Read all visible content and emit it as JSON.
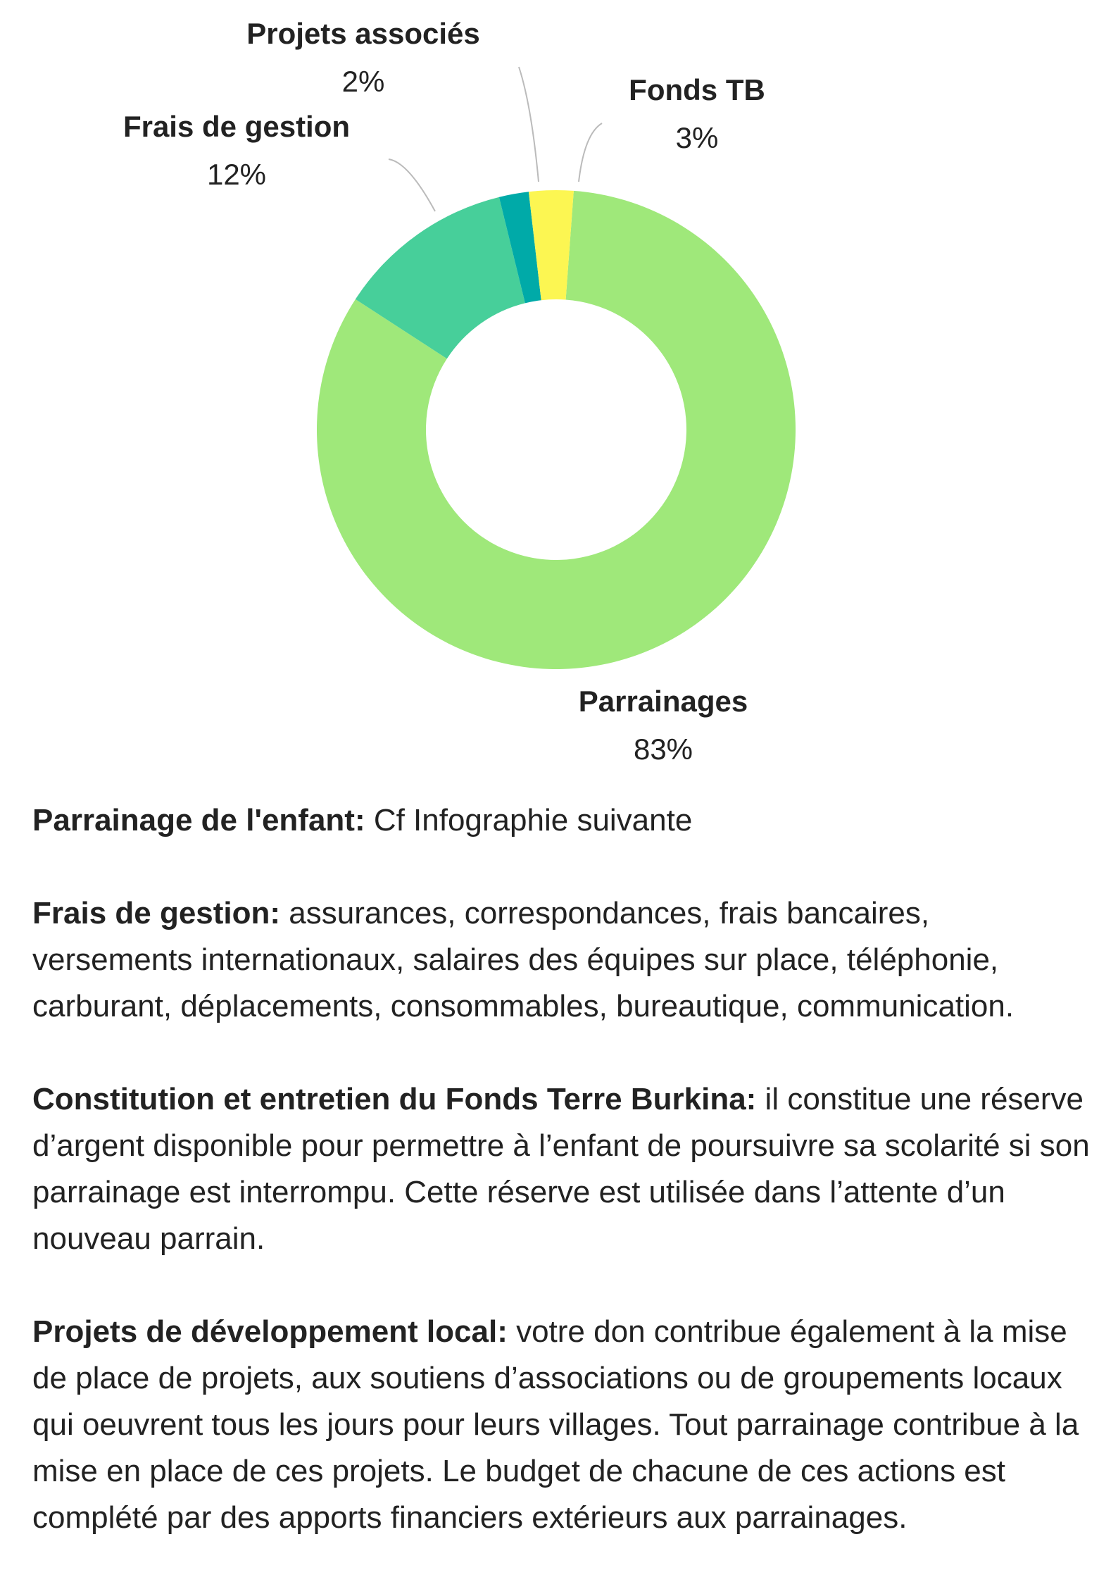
{
  "chart_data": {
    "type": "pie",
    "variant": "donut",
    "categories": [
      "Parrainages",
      "Frais de gestion",
      "Projets associés",
      "Fonds TB"
    ],
    "values": [
      83,
      12,
      2,
      3
    ],
    "value_labels": [
      "83%",
      "12%",
      "2%",
      "3%"
    ],
    "colors": [
      "#9fe87a",
      "#47cf9a",
      "#00aaa8",
      "#fcf652"
    ],
    "title": "",
    "legend": "none"
  },
  "description": [
    {
      "term": "Parrainage de l'enfant:",
      "text": " Cf Infographie suivante"
    },
    {
      "term": "Frais de gestion:",
      "text": " assurances, correspondances, frais bancaires, versements internationaux, salaires des équipes sur place, téléphonie, carburant, déplacements, consommables, bureautique, communication."
    },
    {
      "term": "Constitution et entretien du Fonds Terre Burkina:",
      "text": " il constitue une réserve d’argent disponible pour permettre à l’enfant de poursuivre sa scolarité si son parrainage est interrompu. Cette réserve est utilisée dans l’attente d’un nouveau parrain."
    },
    {
      "term": "Projets de développement local:",
      "text": " votre don contribue également à la mise de place de projets, aux soutiens d’associations ou de groupements locaux qui oeuvrent tous les jours pour leurs villages. Tout parrainage contribue à la mise en place de ces projets. Le budget de chacune de ces actions est complété par des apports financiers extérieurs aux parrainages."
    }
  ]
}
